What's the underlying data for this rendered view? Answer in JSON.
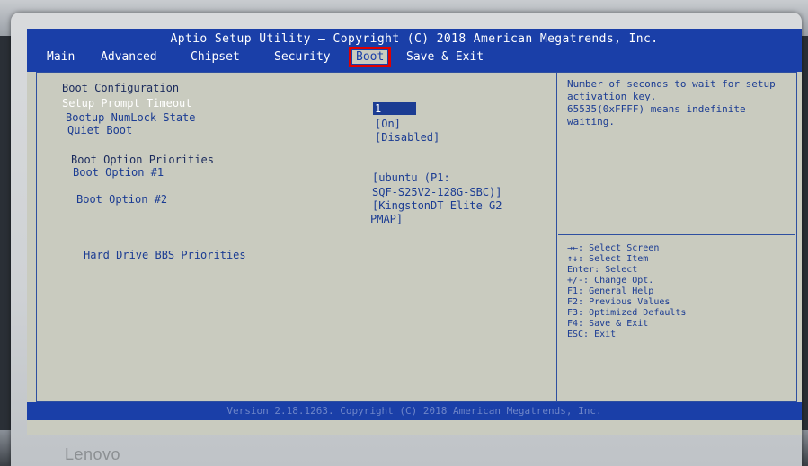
{
  "bios": {
    "title": "Aptio Setup Utility – Copyright (C) 2018 American Megatrends, Inc.",
    "tabs": [
      "Main",
      "Advanced",
      "Chipset",
      "Security",
      "Boot",
      "Save & Exit"
    ],
    "active_tab": "Boot",
    "section_title": "Boot Configuration",
    "rows": {
      "setup_prompt_timeout_label": "Setup Prompt Timeout",
      "setup_prompt_timeout_value": "1",
      "bootup_numlock_label": "Bootup NumLock State",
      "bootup_numlock_value": "[On]",
      "quiet_boot_label": "Quiet Boot",
      "quiet_boot_value": "[Disabled]",
      "boot_priorities_title": "Boot Option Priorities",
      "boot_option1_label": "Boot Option #1",
      "boot_option1_value_line1": "[ubuntu (P1:",
      "boot_option1_value_line2": "SQF-S25V2-128G-SBC)]",
      "boot_option2_label": "Boot Option #2",
      "boot_option2_value_line1": "[KingstonDT Elite G2",
      "boot_option2_value_line2": "PMAP]",
      "hdd_bbs_label": "Hard Drive BBS Priorities"
    },
    "help": "Number of seconds to wait for setup activation key.\n65535(0xFFFF) means indefinite waiting.",
    "keys": [
      "→←: Select Screen",
      "↑↓: Select Item",
      "Enter: Select",
      "+/-: Change Opt.",
      "F1: General Help",
      "F2: Previous Values",
      "F3: Optimized Defaults",
      "F4: Save & Exit",
      "ESC: Exit"
    ],
    "footer": "Version 2.18.1263. Copyright (C) 2018 American Megatrends, Inc."
  },
  "device": {
    "brand": "Lenovo"
  },
  "colors": {
    "header_blue": "#1a3fa8",
    "text_blue": "#1b3c93",
    "screen_bg": "#c9cbbf",
    "highlight_red": "#e00000"
  }
}
